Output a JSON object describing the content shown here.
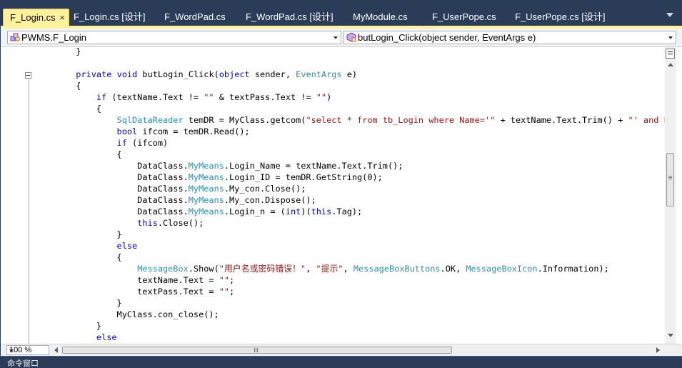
{
  "tabs": [
    {
      "label": "F_Login.cs",
      "active": true,
      "close": "×"
    },
    {
      "label": "F_Login.cs [设计]"
    },
    {
      "label": "F_WordPad.cs"
    },
    {
      "label": "F_WordPad.cs [设计]"
    },
    {
      "label": "MyModule.cs"
    },
    {
      "label": "F_UserPope.cs"
    },
    {
      "label": "F_UserPope.cs [设计]"
    }
  ],
  "navbar": {
    "class_combo": "PWMS.F_Login",
    "member_combo": "butLogin_Click(object sender, EventArgs e)",
    "class_icon": "class-icon",
    "member_icon": "method-icon"
  },
  "code_lines": [
    "        }",
    "",
    "        private void butLogin_Click(object sender, EventArgs e)",
    "        {",
    "            if (textName.Text != \"\" & textPass.Text != \"\")",
    "            {",
    "                SqlDataReader temDR = MyClass.getcom(\"select * from tb_Login where Name='\" + textName.Text.Trim() + \"' and Pas",
    "                bool ifcom = temDR.Read();",
    "                if (ifcom)",
    "                {",
    "                    DataClass.MyMeans.Login_Name = textName.Text.Trim();",
    "                    DataClass.MyMeans.Login_ID = temDR.GetString(0);",
    "                    DataClass.MyMeans.My_con.Close();",
    "                    DataClass.MyMeans.My_con.Dispose();",
    "                    DataClass.MyMeans.Login_n = (int)(this.Tag);",
    "                    this.Close();",
    "                }",
    "                else",
    "                {",
    "                    MessageBox.Show(\"用户名或密码错误！\", \"提示\", MessageBoxButtons.OK, MessageBoxIcon.Information);",
    "                    textName.Text = \"\";",
    "                    textPass.Text = \"\";",
    "                }",
    "                MyClass.con_close();",
    "            }",
    "            else"
  ],
  "zoom": "100 %",
  "bottom_panel_label": "命令窗口",
  "colors": {
    "keyword": "#0000ff",
    "type": "#2b91af",
    "string": "#a31515",
    "tab_active": "#fff29d",
    "chrome": "#2b3c59"
  }
}
